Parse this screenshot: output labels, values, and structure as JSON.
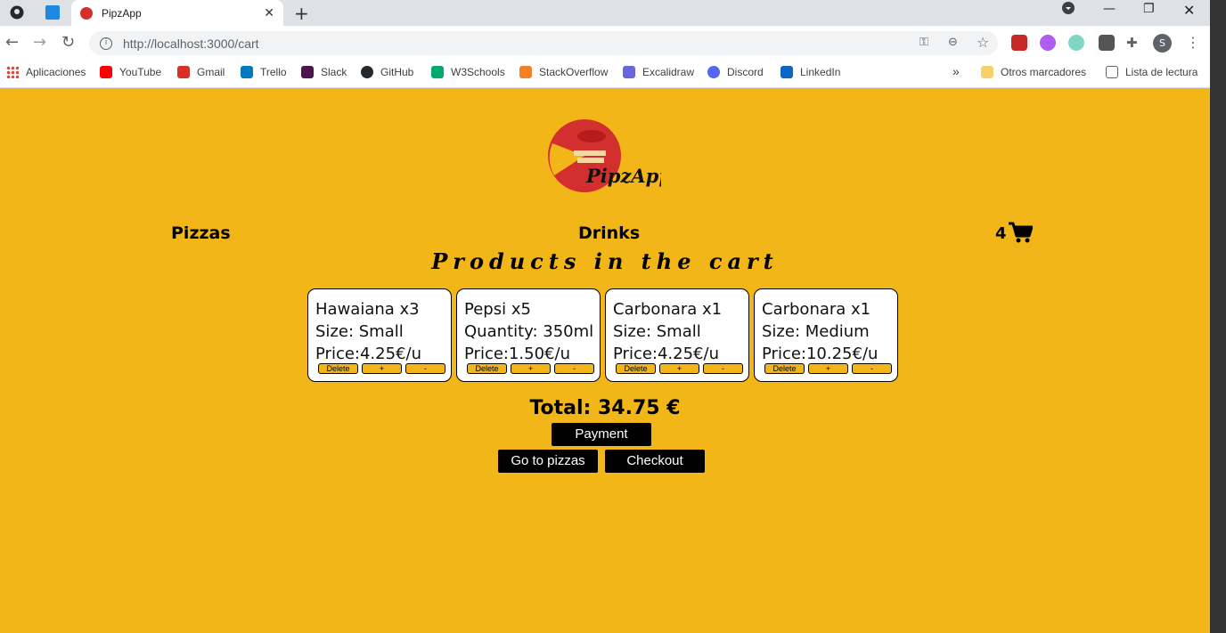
{
  "browser": {
    "tab_title": "PipzApp",
    "url": "http://localhost:3000/cart",
    "profile_initial": "S",
    "bookmarks": [
      {
        "label": "Aplicaciones",
        "color": "#ea4335"
      },
      {
        "label": "YouTube",
        "color": "#ff0000"
      },
      {
        "label": "Gmail",
        "color": "#d93025"
      },
      {
        "label": "Trello",
        "color": "#0079bf"
      },
      {
        "label": "Slack",
        "color": "#4a154b"
      },
      {
        "label": "GitHub",
        "color": "#24292e"
      },
      {
        "label": "W3Schools",
        "color": "#04aa6d"
      },
      {
        "label": "StackOverflow",
        "color": "#f48024"
      },
      {
        "label": "Excalidraw",
        "color": "#6965db"
      },
      {
        "label": "Discord",
        "color": "#5865f2"
      },
      {
        "label": "LinkedIn",
        "color": "#0a66c2"
      }
    ],
    "more_bookmarks": "»",
    "other_bookmarks": "Otros marcadores",
    "reading_list": "Lista de lectura"
  },
  "app": {
    "logo_text": "PipzApp",
    "nav": {
      "pizzas": "Pizzas",
      "drinks": "Drinks"
    },
    "cart_count": "4",
    "heading": "Products in the cart",
    "items": [
      {
        "line1": "Hawaiana x3",
        "line2": "Size: Small",
        "line3": "Price:4.25€/u"
      },
      {
        "line1": "Pepsi x5",
        "line2": "Quantity: 350ml",
        "line3": "Price:1.50€/u"
      },
      {
        "line1": "Carbonara x1",
        "line2": "Size: Small",
        "line3": "Price:4.25€/u"
      },
      {
        "line1": "Carbonara x1",
        "line2": "Size: Medium",
        "line3": "Price:10.25€/u"
      }
    ],
    "item_buttons": {
      "delete": "Delete",
      "plus": "+",
      "minus": "-"
    },
    "total": "Total: 34.75 €",
    "payment_label": "Payment",
    "go_pizzas_label": "Go to pizzas",
    "checkout_label": "Checkout"
  },
  "colors": {
    "page_bg": "#f3b618",
    "logo_red": "#d32f2f"
  }
}
